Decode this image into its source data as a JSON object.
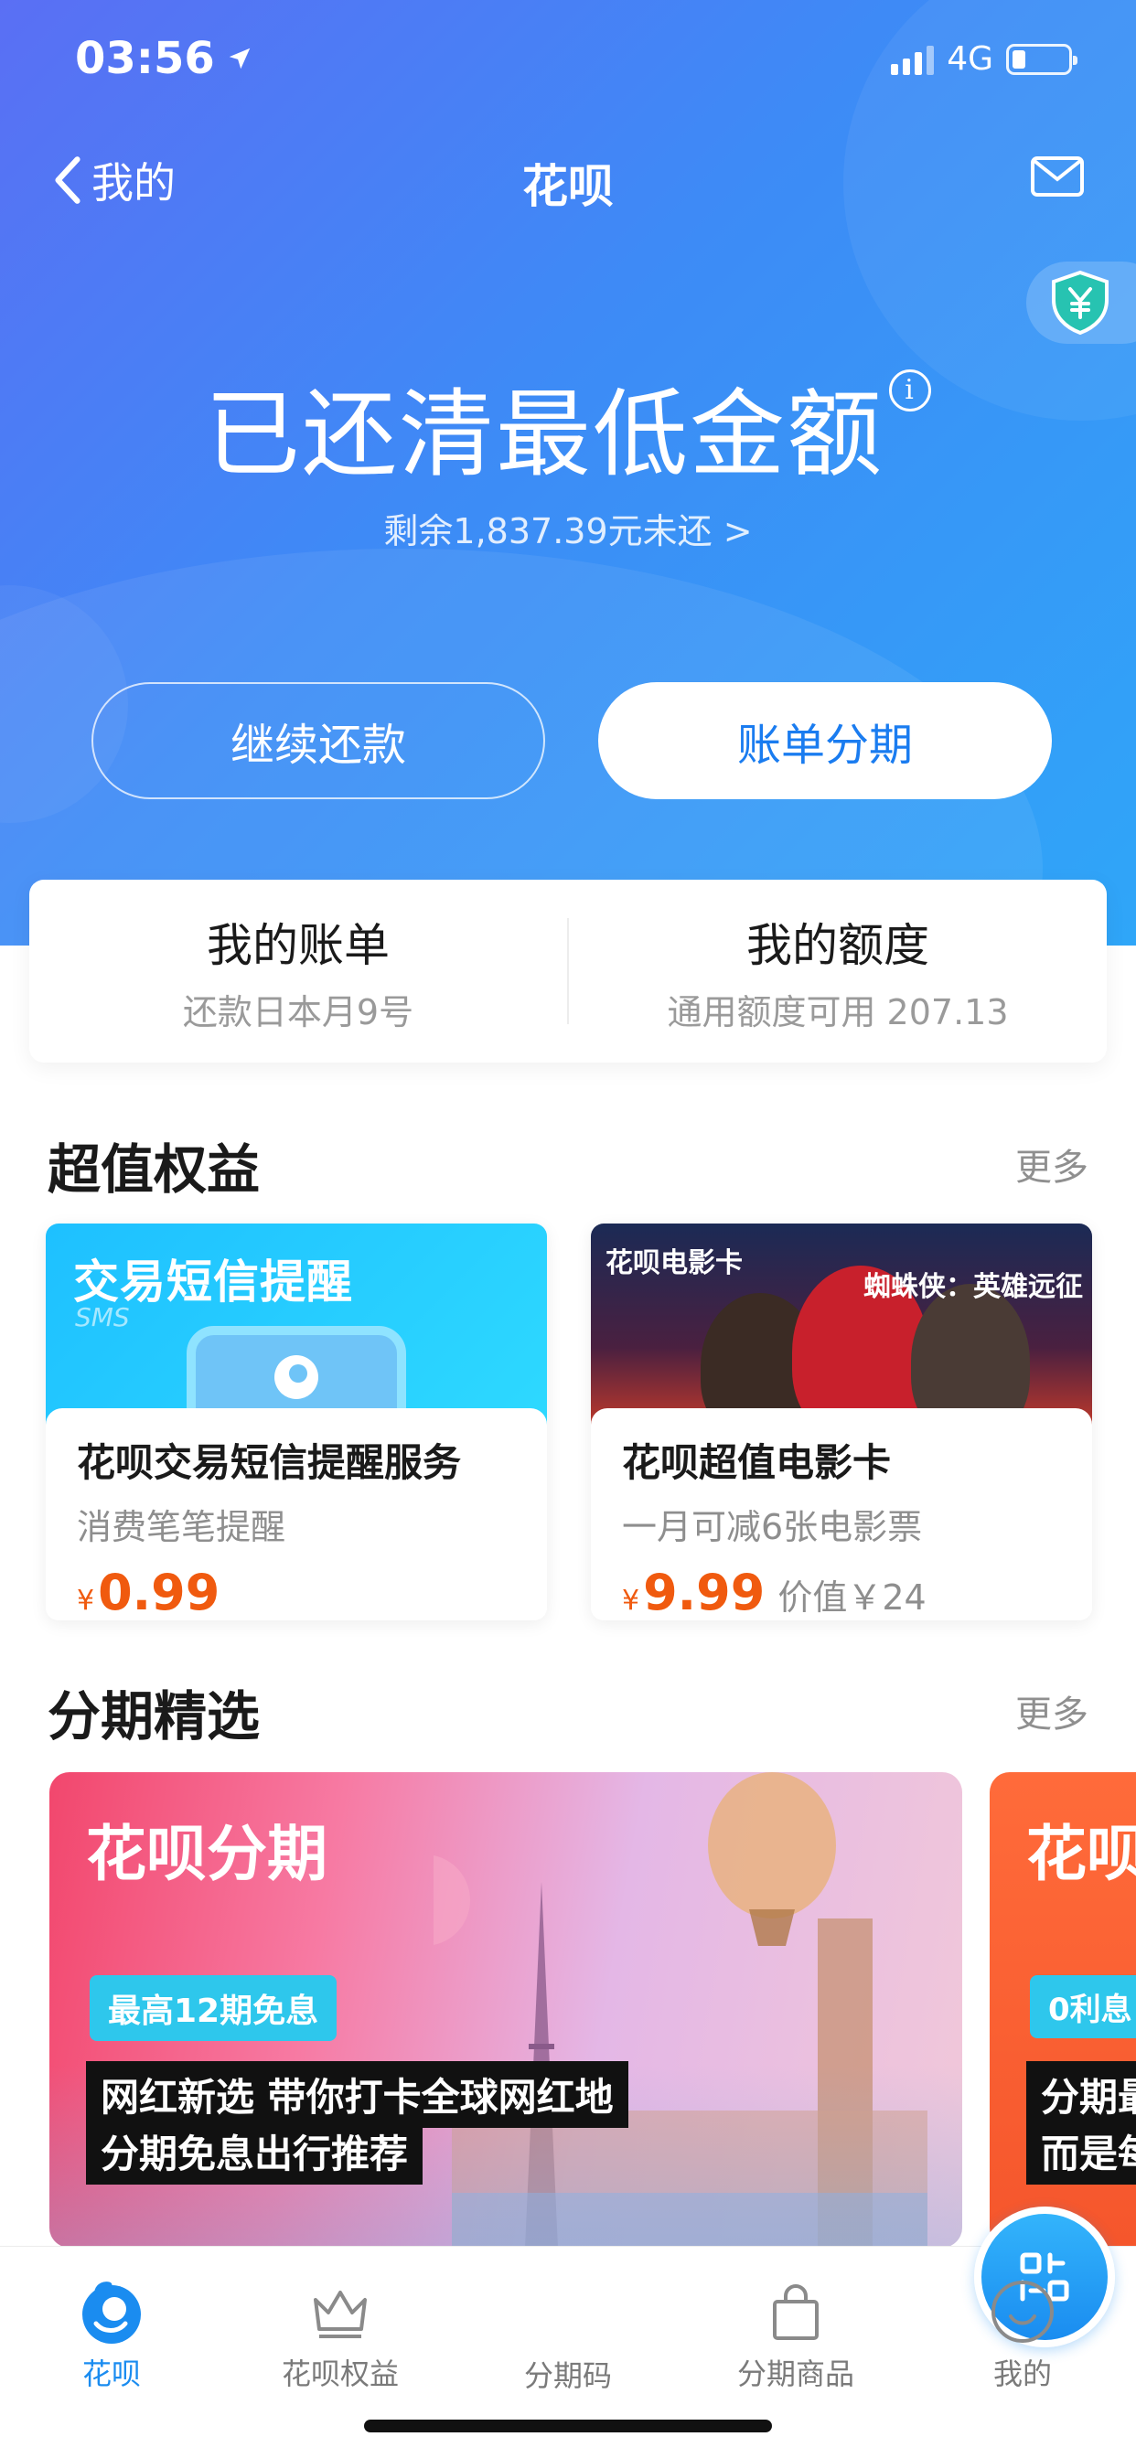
{
  "status_bar": {
    "time": "03:56",
    "network": "4G"
  },
  "nav": {
    "back_label": "我的",
    "title": "花呗"
  },
  "hero": {
    "status_text": "已还清最低金额",
    "info_glyph": "i",
    "remaining_text": "剩余1,837.39元未还 >",
    "continue_button": "继续还款",
    "installment_button": "账单分期"
  },
  "summary": {
    "bill_title": "我的账单",
    "bill_sub": "还款日本月9号",
    "quota_title": "我的额度",
    "quota_sub": "通用额度可用 207.13"
  },
  "benefits": {
    "title": "超值权益",
    "more": "更多",
    "cards": [
      {
        "banner_title": "交易短信提醒",
        "banner_sub": "SMS",
        "name": "花呗交易短信提醒服务",
        "desc": "消费笔笔提醒",
        "currency": "¥",
        "price": "0.99",
        "original": ""
      },
      {
        "banner_title": "花呗电影卡",
        "banner_sub": "蜘蛛侠：英雄远征",
        "name": "花呗超值电影卡",
        "desc": "一月可减6张电影票",
        "currency": "¥",
        "price": "9.99",
        "original": "价值￥24"
      }
    ]
  },
  "installments": {
    "title": "分期精选",
    "more": "更多",
    "promos": [
      {
        "title": "花呗分期",
        "tag": "最高12期免息",
        "line1": "网红新选 带你打卡全球网红地",
        "line2": "分期免息出行推荐"
      },
      {
        "title": "花呗",
        "tag": "0利息",
        "line1": "分期最",
        "line2": "而是每"
      }
    ]
  },
  "tabbar": {
    "items": [
      {
        "label": "花呗",
        "icon": "huabei-logo-icon"
      },
      {
        "label": "花呗权益",
        "icon": "crown-icon"
      },
      {
        "label": "分期码",
        "icon": "qr-code-icon"
      },
      {
        "label": "分期商品",
        "icon": "shopping-bag-icon"
      },
      {
        "label": "我的",
        "icon": "smiley-icon"
      }
    ]
  },
  "colors": {
    "accent": "#1a8cf0",
    "price": "#f05a0f",
    "hero_start": "#5a6ff4",
    "hero_end": "#2fa6f8"
  }
}
